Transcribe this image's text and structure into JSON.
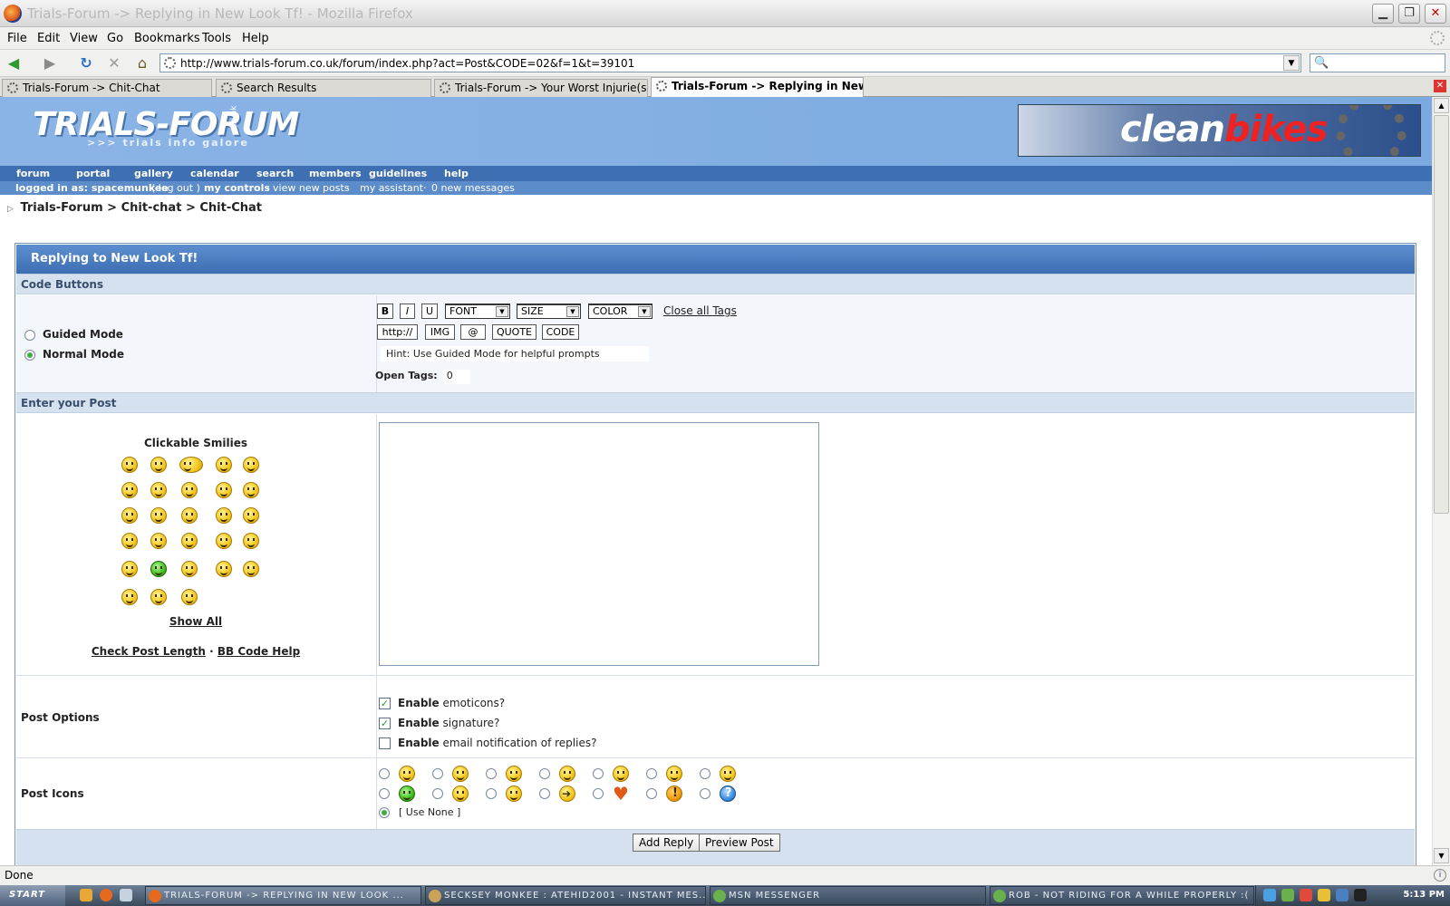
{
  "window": {
    "title": "Trials-Forum -> Replying in New Look Tf! - Mozilla Firefox",
    "minimize": "▁",
    "maximize": "❐",
    "close": "✕"
  },
  "menubar": [
    "File",
    "Edit",
    "View",
    "Go",
    "Bookmarks",
    "Tools",
    "Help"
  ],
  "nav": {
    "back": "◀",
    "forward": "▶",
    "reload": "↻",
    "stop": "✕",
    "home": "⌂",
    "url": "http://www.trials-forum.co.uk/forum/index.php?act=Post&CODE=02&f=1&t=39101",
    "search_icon": "🔍"
  },
  "tabs": [
    {
      "label": "Trials-Forum -> Chit-Chat",
      "active": false
    },
    {
      "label": "Search Results",
      "active": false
    },
    {
      "label": "Trials-Forum -> Your Worst Injurie(s)",
      "active": false
    },
    {
      "label": "Trials-Forum -> Replying in New...",
      "active": true
    }
  ],
  "site": {
    "logo": "TRIALS-FORUM",
    "logo_sub": ">>> trials info galore",
    "logo_co": ".co.uk",
    "ad_word_white": "clean",
    "ad_word_red": "bikes",
    "nav_links": [
      "forum",
      "portal",
      "gallery",
      "calendar",
      "search",
      "members",
      "guidelines",
      "help"
    ],
    "user_bar": {
      "logged_in": "logged in as: spacemunkee",
      "logout": "( log out )",
      "controls": "my controls",
      "sep1": "·",
      "new_posts": "view new posts",
      "sep2": "·",
      "assistant": "my assistant",
      "sep3": "·",
      "messages": "0 new messages"
    },
    "breadcrumb": [
      "Trials-Forum",
      "Chit-chat",
      "Chit-Chat"
    ],
    "breadcrumb_sep": ">",
    "breadcrumb_arrow": "▷"
  },
  "form": {
    "title": "Replying to New Look Tf!",
    "code_buttons_header": "Code Buttons",
    "guided_mode": "Guided Mode",
    "normal_mode": "Normal Mode",
    "mode_selected": "Normal Mode",
    "buttons_row1": [
      "B",
      "I",
      "U"
    ],
    "selects": [
      {
        "selected": "FONT"
      },
      {
        "selected": "SIZE"
      },
      {
        "selected": "COLOR"
      }
    ],
    "close_all_tags": "Close all Tags",
    "buttons_row2": [
      "http://",
      "IMG",
      "@",
      "QUOTE",
      "CODE"
    ],
    "hint": "Hint: Use Guided Mode for helpful prompts",
    "open_tags_label": "Open Tags:",
    "open_tags_value": "0",
    "enter_post_header": "Enter your Post",
    "smilies_title": "Clickable Smilies",
    "show_all": "Show All",
    "check_post_length": "Check Post Length",
    "help_sep": "·",
    "bb_code_help": "BB Code Help",
    "post_text": "",
    "post_options_label": "Post Options",
    "options": [
      {
        "bold": "Enable",
        "text": "emoticons?",
        "checked": true
      },
      {
        "bold": "Enable",
        "text": "signature?",
        "checked": true
      },
      {
        "bold": "Enable",
        "text": "email notification of replies?",
        "checked": false
      }
    ],
    "post_icons_label": "Post Icons",
    "use_none": "[ Use None ]",
    "add_reply": "Add Reply",
    "preview_post": "Preview Post"
  },
  "status": {
    "text": "Done"
  },
  "taskbar": {
    "start": "START",
    "tasks": [
      {
        "label": "TRIALS-FORUM -> REPLYING IN NEW LOOK ...",
        "active": true
      },
      {
        "label": "SECKSEY MONKEE : ATEHID2001 - INSTANT MES...",
        "active": false
      },
      {
        "label": "MSN MESSENGER",
        "active": false
      },
      {
        "label": "ROB - NOT RIDING FOR A WHILE PROPERLY :( - CON...",
        "active": false
      }
    ],
    "clock": "5:13 PM"
  }
}
